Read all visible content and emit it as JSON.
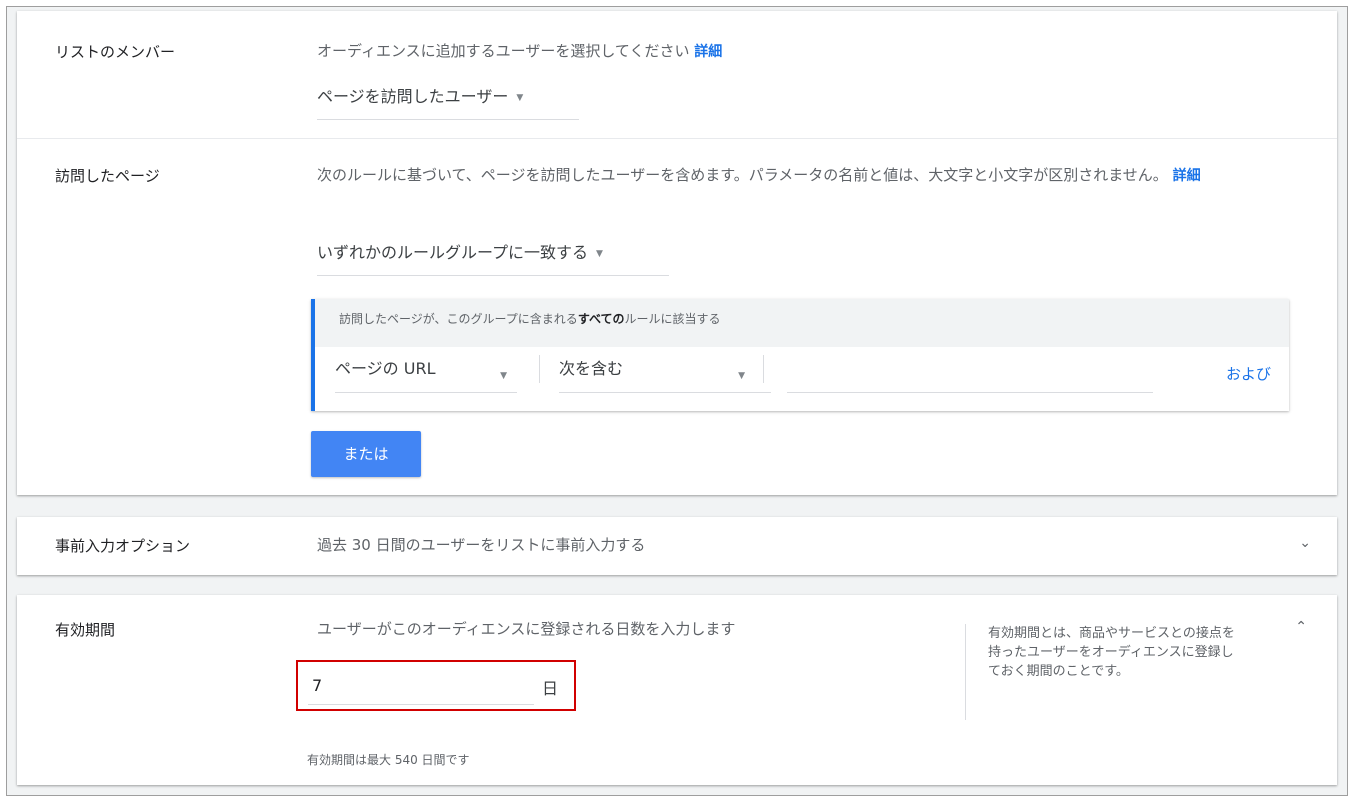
{
  "list_members": {
    "label": "リストのメンバー",
    "description": "オーディエンスに追加するユーザーを選択してください",
    "details_link": "詳細",
    "dropdown_value": "ページを訪問したユーザー"
  },
  "visited_pages": {
    "label": "訪問したページ",
    "description": "次のルールに基づいて、ページを訪問したユーザーを含めます。パラメータの名前と値は、大文字と小文字が区別されません。",
    "details_link": "詳細",
    "match_dropdown": "いずれかのルールグループに一致する",
    "rule_group": {
      "header_prefix": "訪問したページが、このグループに含まれる",
      "header_bold": "すべての",
      "header_suffix": "ルールに該当する",
      "field_select": "ページの URL",
      "operator_select": "次を含む",
      "value_input": "",
      "and_link": "および"
    },
    "or_button": "または"
  },
  "prefill": {
    "label": "事前入力オプション",
    "description": "過去 30 日間のユーザーをリストに事前入力する",
    "expand_icon": "chevron-down-icon"
  },
  "duration": {
    "label": "有効期間",
    "description": "ユーザーがこのオーディエンスに登録される日数を入力します",
    "days_value": "7",
    "days_unit": "日",
    "help": "有効期間とは、商品やサービスとの接点を持ったユーザーをオーディエンスに登録しておく期間のことです。",
    "note": "有効期間は最大 540 日間です",
    "collapse_icon": "chevron-up-icon"
  },
  "colors": {
    "accent": "#1a73e8",
    "button": "#4285f4",
    "highlight_box": "#d10000"
  }
}
